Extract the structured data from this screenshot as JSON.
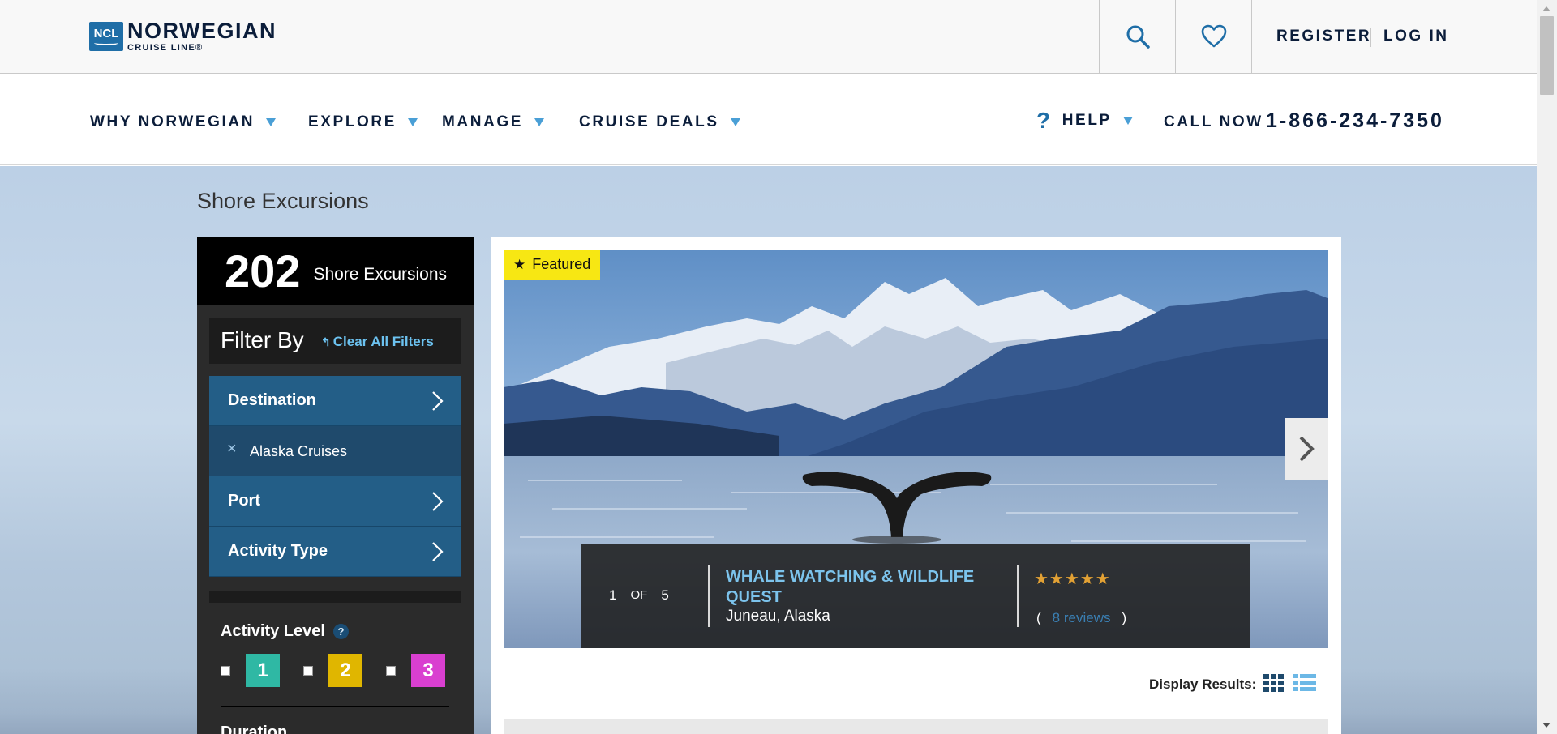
{
  "brand": {
    "logo_abbr": "NCL",
    "name_line1": "NORWEGIAN",
    "name_line2": "CRUISE LINE®"
  },
  "header": {
    "search_icon": "search-icon",
    "favorites_icon": "heart-icon",
    "register": "REGISTER",
    "login": "LOG IN"
  },
  "nav": {
    "items": [
      {
        "label": "WHY NORWEGIAN"
      },
      {
        "label": "EXPLORE"
      },
      {
        "label": "MANAGE"
      },
      {
        "label": "CRUISE DEALS"
      }
    ],
    "help_label": "HELP",
    "call_now": "CALL NOW",
    "phone": "1-866-234-7350"
  },
  "page": {
    "title": "Shore Excursions"
  },
  "sidebar": {
    "count": "202",
    "count_label": "Shore Excursions",
    "filter_by": "Filter By",
    "clear_all": "Clear All Filters",
    "filters": [
      {
        "label": "Destination"
      },
      {
        "label": "Port"
      },
      {
        "label": "Activity Type"
      }
    ],
    "selected_destination": "Alaska Cruises",
    "activity_level_title": "Activity Level",
    "activity_help": "?",
    "levels": [
      {
        "label": "1",
        "color": "#2fb8a4"
      },
      {
        "label": "2",
        "color": "#e0b600"
      },
      {
        "label": "3",
        "color": "#d93fd0"
      }
    ],
    "duration_title": "Duration"
  },
  "featured": {
    "badge": "Featured",
    "slide_current": "1",
    "slide_of": "OF",
    "slide_total": "5",
    "title": "WHALE WATCHING & WILDLIFE QUEST",
    "location": "Juneau, Alaska",
    "rating_stars": "★★★★★",
    "rating": 4.5,
    "reviews_open": "(",
    "reviews_link": "8 reviews",
    "reviews_close": ")"
  },
  "results": {
    "display_label": "Display Results:"
  },
  "colors": {
    "brand_blue": "#1f6ea7",
    "filter_blue": "#235e87",
    "accent_link": "#6cc2f0",
    "featured_yellow": "#f7e713"
  }
}
